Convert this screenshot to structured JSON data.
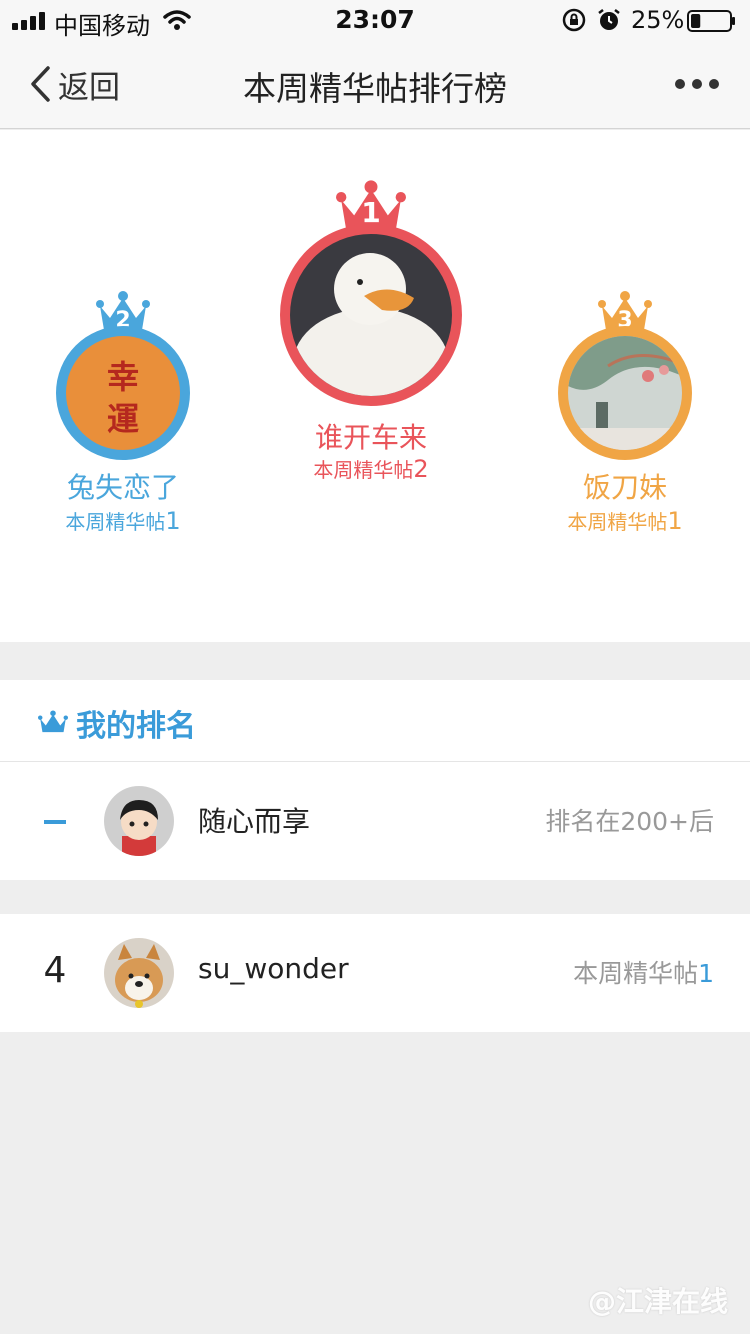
{
  "status_bar": {
    "carrier": "中国移动",
    "time": "23:07",
    "battery": "25%",
    "battery_level": 0.25
  },
  "nav": {
    "back_label": "返回",
    "title": "本周精华帖排行榜"
  },
  "podium": {
    "first": {
      "rank": "1",
      "name": "谁开车来",
      "label": "本周精华帖",
      "count": "2",
      "color": "#e9545a"
    },
    "second": {
      "rank": "2",
      "name": "兔失恋了",
      "label": "本周精华帖",
      "count": "1",
      "color": "#4aa6dc",
      "avatar_text_1": "幸",
      "avatar_text_2": "運"
    },
    "third": {
      "rank": "3",
      "name": "饭刀妹",
      "label": "本周精华帖",
      "count": "1",
      "color": "#f0a545"
    }
  },
  "my_rank": {
    "title": "我的排名",
    "name": "随心而享",
    "rank_text": "排名在200+后"
  },
  "list": [
    {
      "rank": "4",
      "name": "su_wonder",
      "label": "本周精华帖",
      "count": "1"
    }
  ],
  "watermark": "@江津在线",
  "colors": {
    "accent": "#3a9bd9",
    "gold": "#e9545a"
  }
}
